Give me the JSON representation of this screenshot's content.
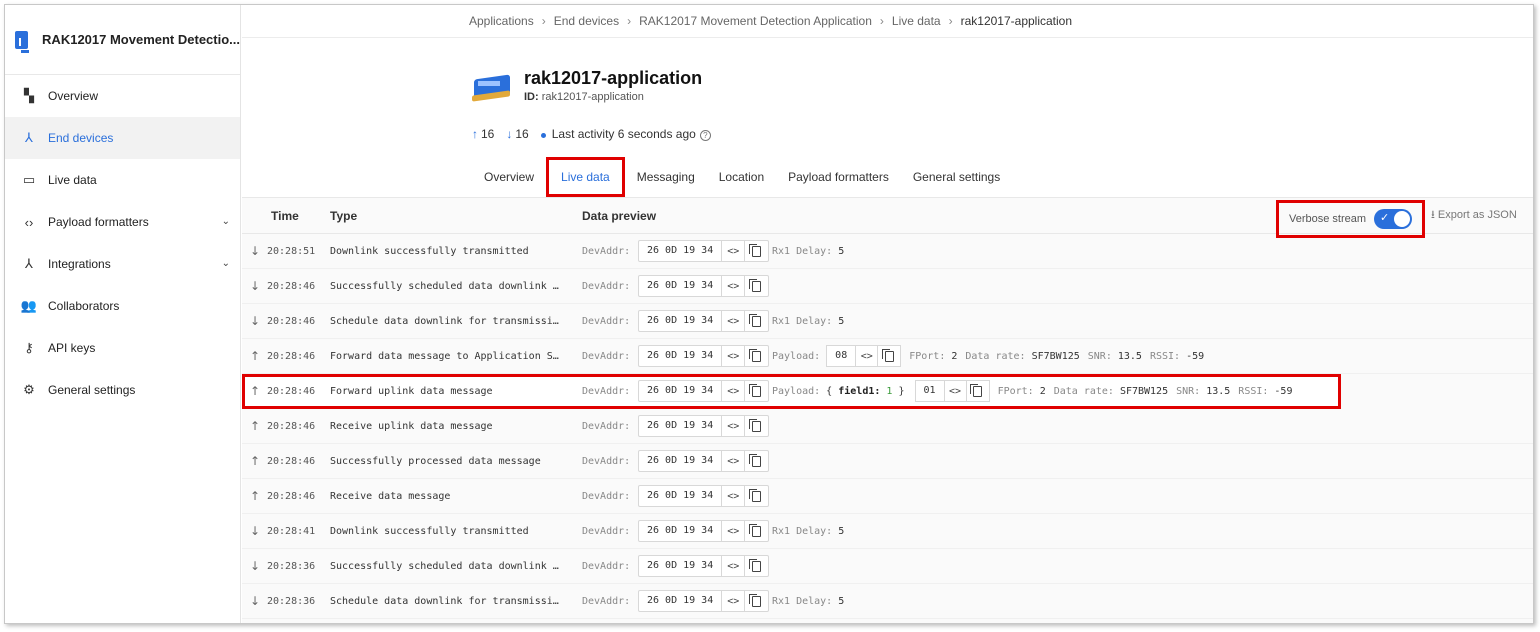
{
  "sidebar": {
    "app_title": "RAK12017 Movement Detectio...",
    "items": [
      {
        "label": "Overview",
        "icon": "dashboard-icon"
      },
      {
        "label": "End devices",
        "icon": "device-hub-icon",
        "active": true
      },
      {
        "label": "Live data",
        "icon": "list-icon"
      },
      {
        "label": "Payload formatters",
        "icon": "code-icon",
        "expandable": true
      },
      {
        "label": "Integrations",
        "icon": "merge-icon",
        "expandable": true
      },
      {
        "label": "Collaborators",
        "icon": "people-icon"
      },
      {
        "label": "API keys",
        "icon": "key-icon"
      },
      {
        "label": "General settings",
        "icon": "gear-icon"
      }
    ]
  },
  "breadcrumb": [
    "Applications",
    "End devices",
    "RAK12017 Movement Detection Application",
    "Live data",
    "rak12017-application"
  ],
  "device": {
    "name": "rak12017-application",
    "id_label": "ID:",
    "id_value": "rak12017-application",
    "uplink_count": "16",
    "downlink_count": "16",
    "last_activity": "Last activity 6 seconds ago"
  },
  "tabs": [
    "Overview",
    "Live data",
    "Messaging",
    "Location",
    "Payload formatters",
    "General settings"
  ],
  "table": {
    "headers": {
      "time": "Time",
      "type": "Type",
      "preview": "Data preview"
    },
    "verbose_label": "Verbose stream",
    "export_label": "Export as JSON",
    "rows": [
      {
        "dir": "down",
        "time": "20:28:51",
        "type": "Downlink successfully transmitted",
        "addr": "26 0D 19 34",
        "extra": "rx1"
      },
      {
        "dir": "down",
        "time": "20:28:46",
        "type": "Successfully scheduled data downlink …",
        "addr": "26 0D 19 34",
        "extra": "none"
      },
      {
        "dir": "down",
        "time": "20:28:46",
        "type": "Schedule data downlink for transmissi…",
        "addr": "26 0D 19 34",
        "extra": "rx1"
      },
      {
        "dir": "up",
        "time": "20:28:46",
        "type": "Forward data message to Application S…",
        "addr": "26 0D 19 34",
        "extra": "payload"
      },
      {
        "dir": "up",
        "time": "20:28:46",
        "type": "Forward uplink data message",
        "addr": "26 0D 19 34",
        "extra": "uplink"
      },
      {
        "dir": "up",
        "time": "20:28:46",
        "type": "Receive uplink data message",
        "addr": "26 0D 19 34",
        "extra": "none"
      },
      {
        "dir": "up",
        "time": "20:28:46",
        "type": "Successfully processed data message",
        "addr": "26 0D 19 34",
        "extra": "none"
      },
      {
        "dir": "up",
        "time": "20:28:46",
        "type": "Receive data message",
        "addr": "26 0D 19 34",
        "extra": "none"
      },
      {
        "dir": "down",
        "time": "20:28:41",
        "type": "Downlink successfully transmitted",
        "addr": "26 0D 19 34",
        "extra": "rx1"
      },
      {
        "dir": "down",
        "time": "20:28:36",
        "type": "Successfully scheduled data downlink …",
        "addr": "26 0D 19 34",
        "extra": "none"
      },
      {
        "dir": "down",
        "time": "20:28:36",
        "type": "Schedule data downlink for transmissi…",
        "addr": "26 0D 19 34",
        "extra": "rx1"
      }
    ],
    "devaddr_label": "DevAddr:",
    "rx1_label": "Rx1 Delay:",
    "rx1_value": "5",
    "payload_label": "Payload:",
    "payload_hex_down": "08",
    "payload_hex_up": "01",
    "json_open": "{",
    "json_key": "field1:",
    "json_val": "1",
    "json_close": "}",
    "fport_label": "FPort:",
    "fport_value": "2",
    "datarate_label": "Data rate:",
    "datarate_value": "SF7BW125",
    "snr_label": "SNR:",
    "snr_value": "13.5",
    "rssi_label": "RSSI:",
    "rssi_value": "-59"
  },
  "colors": {
    "accent": "#2a6fdb",
    "highlight": "#e00000"
  }
}
